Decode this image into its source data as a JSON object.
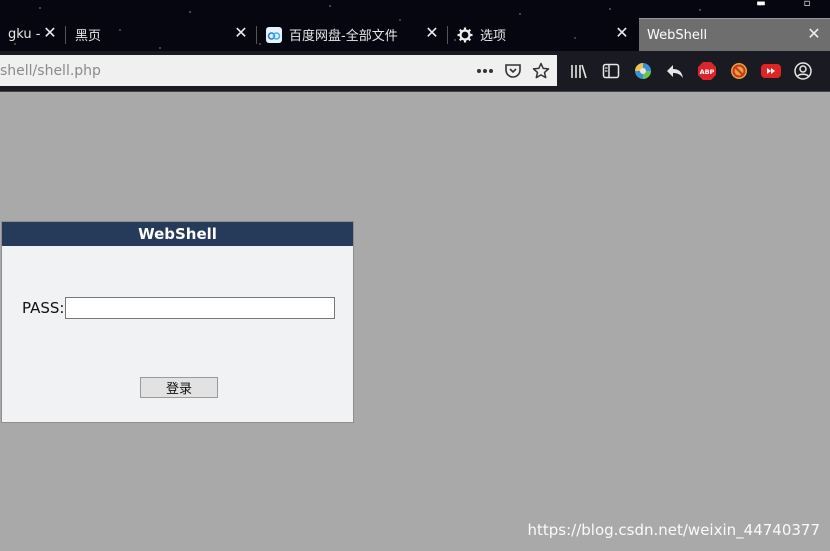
{
  "tabs": [
    {
      "title": "gku - ",
      "active": false
    },
    {
      "title": "黑页",
      "active": false
    },
    {
      "title": "百度网盘-全部文件",
      "active": false
    },
    {
      "title": "选项",
      "active": false
    },
    {
      "title": "WebShell",
      "active": true
    }
  ],
  "address_bar": {
    "url": "shell/shell.php"
  },
  "page": {
    "panel_title": "WebShell",
    "pass_label": "PASS:",
    "pass_value": "",
    "login_label": "登录"
  },
  "watermark": "https://blog.csdn.net/weixin_44740377",
  "colors": {
    "header": "#263a5a",
    "page_bg": "#a9a9a9",
    "panel_bg": "#f1f2f3"
  },
  "icons": [
    "close-icon",
    "baidu-cloud-icon",
    "gear-icon",
    "more-icon",
    "pocket-icon",
    "star-icon",
    "library-icon",
    "sidebar-icon",
    "extension-icon",
    "back-arrow-icon",
    "adblock-icon",
    "block-icon",
    "youtube-icon",
    "account-icon"
  ]
}
